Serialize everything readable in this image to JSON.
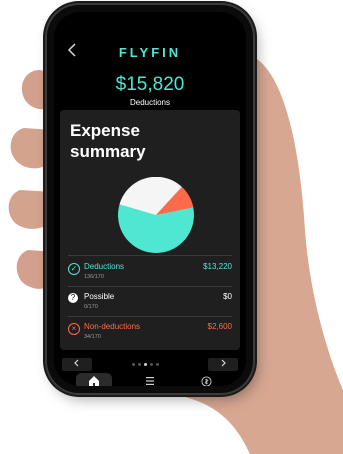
{
  "app": {
    "logo": "FLYFIN",
    "back_icon": "chevron-left-icon",
    "amount": "$15,820",
    "amount_label": "Deductions"
  },
  "card": {
    "title": "Expense summary",
    "pie": {
      "colors": {
        "deductions": "#4fe6d2",
        "possible": "#f5f5f5",
        "non_deductions": "#ff6b4a"
      }
    },
    "rows": [
      {
        "name": "Deductions",
        "count": "136/170",
        "value": "$13,220",
        "icon": "check-circle-icon",
        "color": "#4fe6d2"
      },
      {
        "name": "Possible",
        "count": "0/170",
        "value": "$0",
        "icon": "question-circle-icon",
        "color": "#ffffff"
      },
      {
        "name": "Non-deductions",
        "count": "34/170",
        "value": "$2,600",
        "icon": "x-circle-icon",
        "color": "#ff6b4a"
      }
    ]
  },
  "pager": {
    "prev_icon": "chevron-left-icon",
    "next_icon": "chevron-right-icon",
    "dots": 5,
    "active_dot": 2
  },
  "tabs": [
    {
      "name": "home",
      "icon": "home-icon",
      "active": true
    },
    {
      "name": "list",
      "icon": "list-icon",
      "active": false
    },
    {
      "name": "profile",
      "icon": "dollar-circle-icon",
      "active": false
    }
  ]
}
